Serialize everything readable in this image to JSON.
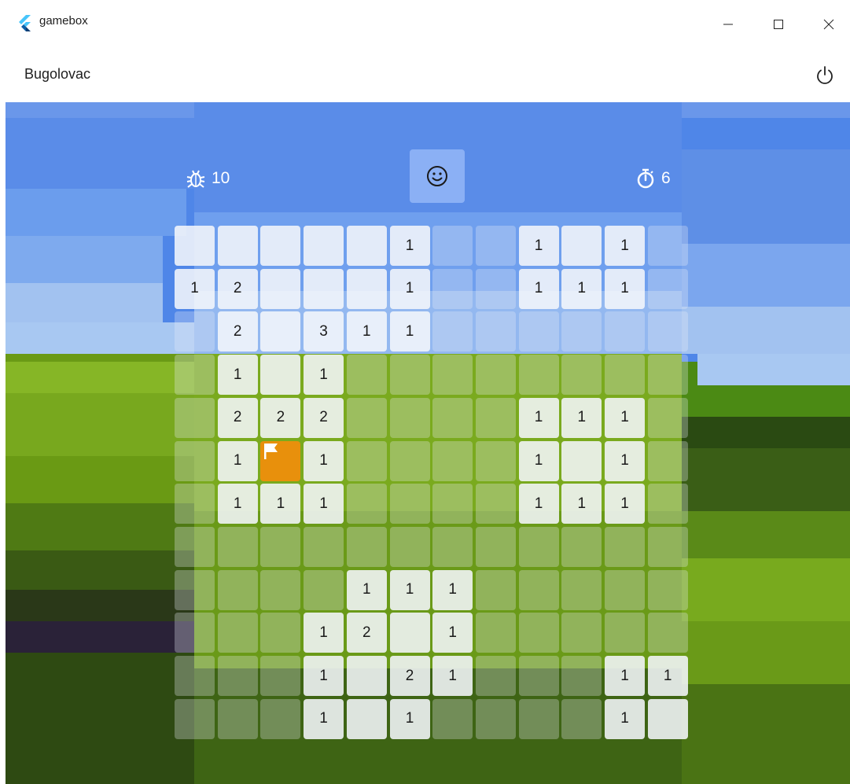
{
  "window": {
    "title": "gamebox",
    "controls": {
      "minimize": "minimize-icon",
      "maximize": "maximize-icon",
      "close": "close-icon"
    }
  },
  "appbar": {
    "title": "Bugolovac",
    "power_icon": "power-icon"
  },
  "status": {
    "mines_remaining": "10",
    "mines_icon": "bug-icon",
    "face_icon": "smiley-face-icon",
    "timer_value": "6",
    "timer_icon": "stopwatch-icon"
  },
  "colors": {
    "flag_cell": "#e8900c",
    "sky": "#4f86e8",
    "grass": "#7aaa1e"
  },
  "board": {
    "rows": 12,
    "cols": 12,
    "legend": "H = hidden, R = revealed empty, F = flagged, digits = revealed number",
    "cells": [
      [
        "R",
        "R",
        "R",
        "R",
        "R",
        "1",
        "H",
        "H",
        "1",
        "R",
        "1",
        "H"
      ],
      [
        "1",
        "2",
        "R",
        "R",
        "R",
        "1",
        "H",
        "H",
        "1",
        "1",
        "1",
        "H"
      ],
      [
        "H",
        "2",
        "R",
        "3",
        "1",
        "1",
        "H",
        "H",
        "H",
        "H",
        "H",
        "H"
      ],
      [
        "H",
        "1",
        "R",
        "1",
        "H",
        "H",
        "H",
        "H",
        "H",
        "H",
        "H",
        "H"
      ],
      [
        "H",
        "2",
        "2",
        "2",
        "H",
        "H",
        "H",
        "H",
        "1",
        "1",
        "1",
        "H"
      ],
      [
        "H",
        "1",
        "F",
        "1",
        "H",
        "H",
        "H",
        "H",
        "1",
        "R",
        "1",
        "H"
      ],
      [
        "H",
        "1",
        "1",
        "1",
        "H",
        "H",
        "H",
        "H",
        "1",
        "1",
        "1",
        "H"
      ],
      [
        "H",
        "H",
        "H",
        "H",
        "H",
        "H",
        "H",
        "H",
        "H",
        "H",
        "H",
        "H"
      ],
      [
        "H",
        "H",
        "H",
        "H",
        "1",
        "1",
        "1",
        "H",
        "H",
        "H",
        "H",
        "H"
      ],
      [
        "H",
        "H",
        "H",
        "1",
        "2",
        "R",
        "1",
        "H",
        "H",
        "H",
        "H",
        "H"
      ],
      [
        "H",
        "H",
        "H",
        "1",
        "R",
        "2",
        "1",
        "H",
        "H",
        "H",
        "1",
        "1"
      ],
      [
        "H",
        "H",
        "H",
        "1",
        "R",
        "1",
        "H",
        "H",
        "H",
        "H",
        "1",
        "R"
      ]
    ]
  }
}
